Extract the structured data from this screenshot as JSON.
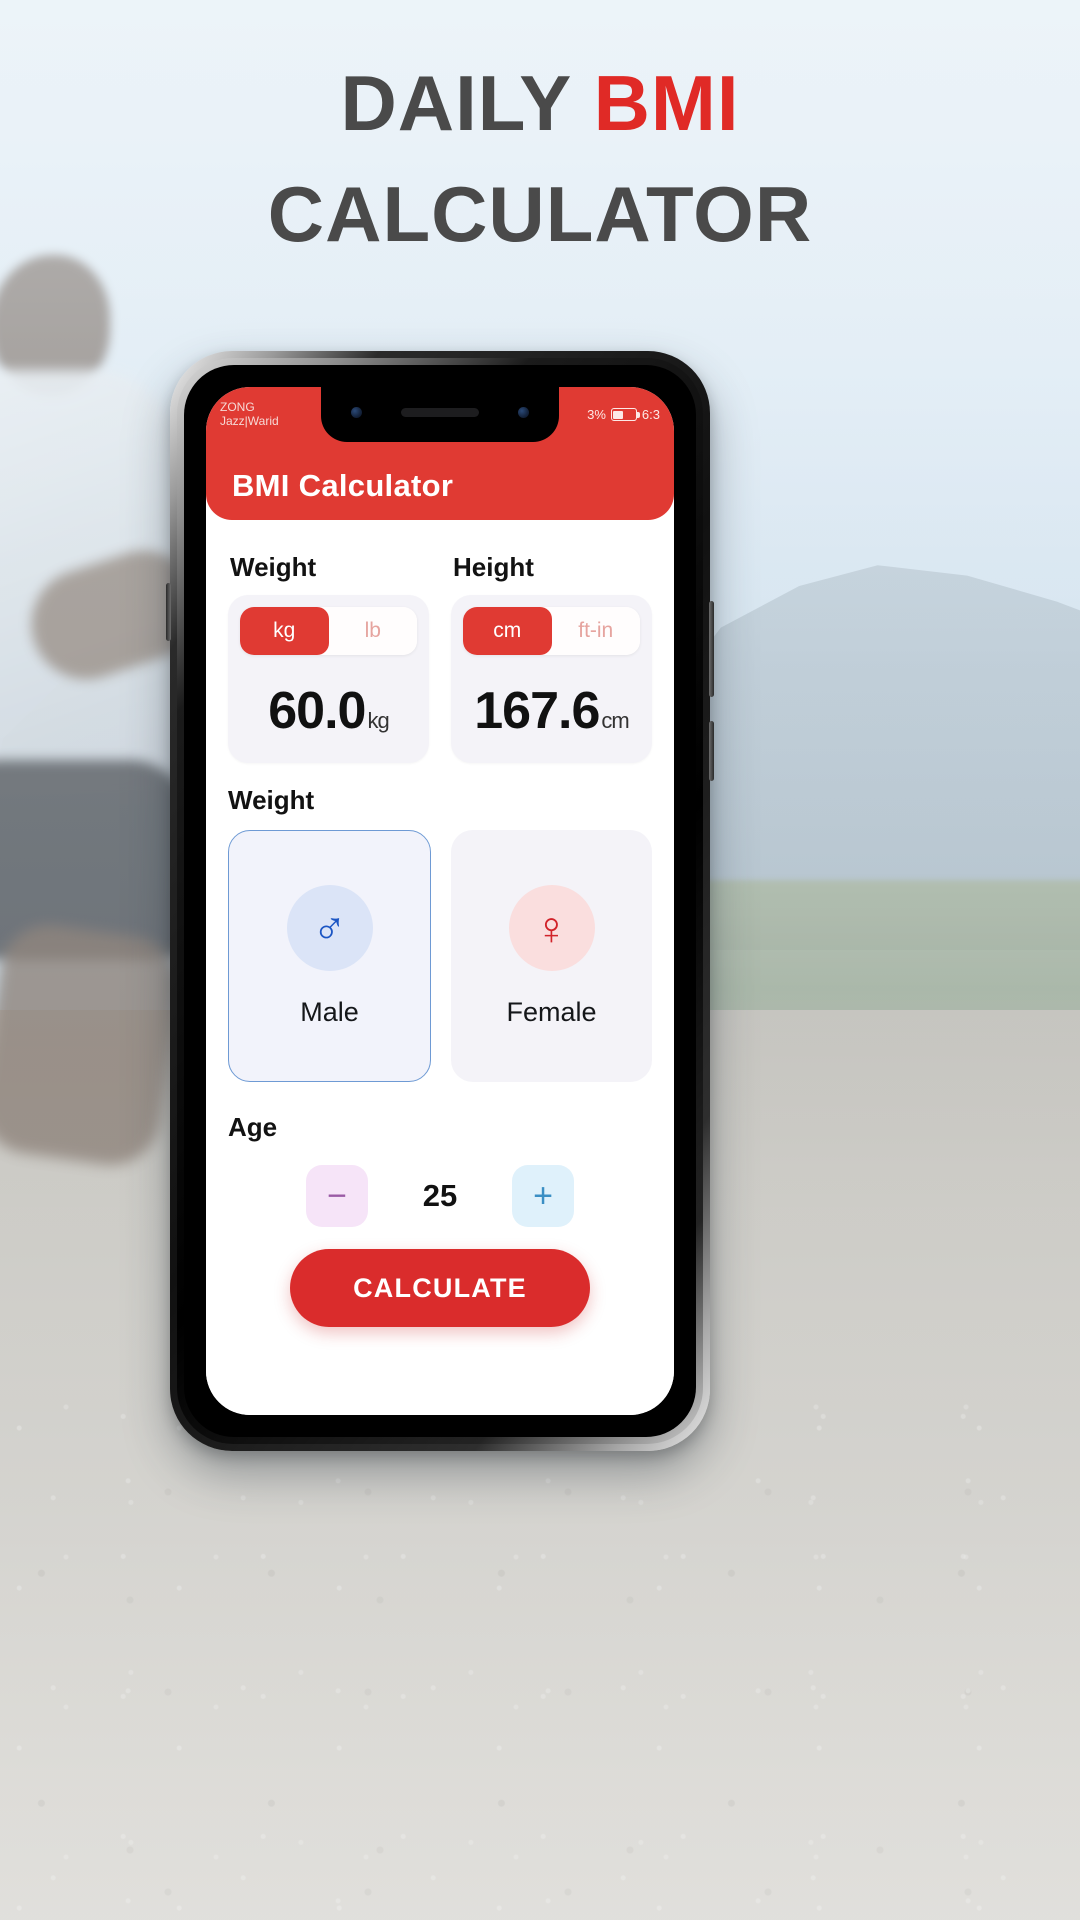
{
  "headline": {
    "line1_plain": "DAILY ",
    "line1_accent": "BMI",
    "line2": "CALCULATOR",
    "plain_color": "#4a4a4a",
    "accent_color": "#e02a26"
  },
  "phone": {
    "status_bar": {
      "carrier_line1": "ZONG",
      "carrier_line2": "Jazz|Warid",
      "battery_percent": "3%",
      "battery_icon": "battery-icon",
      "time": "6:3"
    },
    "app": {
      "header_title": "BMI Calculator",
      "header_color": "#e03a33",
      "weight": {
        "label": "Weight",
        "units": [
          {
            "label": "kg",
            "selected": true
          },
          {
            "label": "lb",
            "selected": false
          }
        ],
        "value": "60.0",
        "unit_suffix": "kg"
      },
      "height": {
        "label": "Height",
        "units": [
          {
            "label": "cm",
            "selected": true
          },
          {
            "label": "ft-in",
            "selected": false
          }
        ],
        "value": "167.6",
        "unit_suffix": "cm"
      },
      "gender": {
        "section_label": "Weight",
        "options": [
          {
            "label": "Male",
            "icon": "male-symbol-icon",
            "glyph": "♂",
            "selected": true
          },
          {
            "label": "Female",
            "icon": "female-symbol-icon",
            "glyph": "♀",
            "selected": false
          }
        ]
      },
      "age": {
        "label": "Age",
        "value": "25",
        "decrement_label": "−",
        "increment_label": "+"
      },
      "calculate_button": "CALCULATE"
    }
  }
}
